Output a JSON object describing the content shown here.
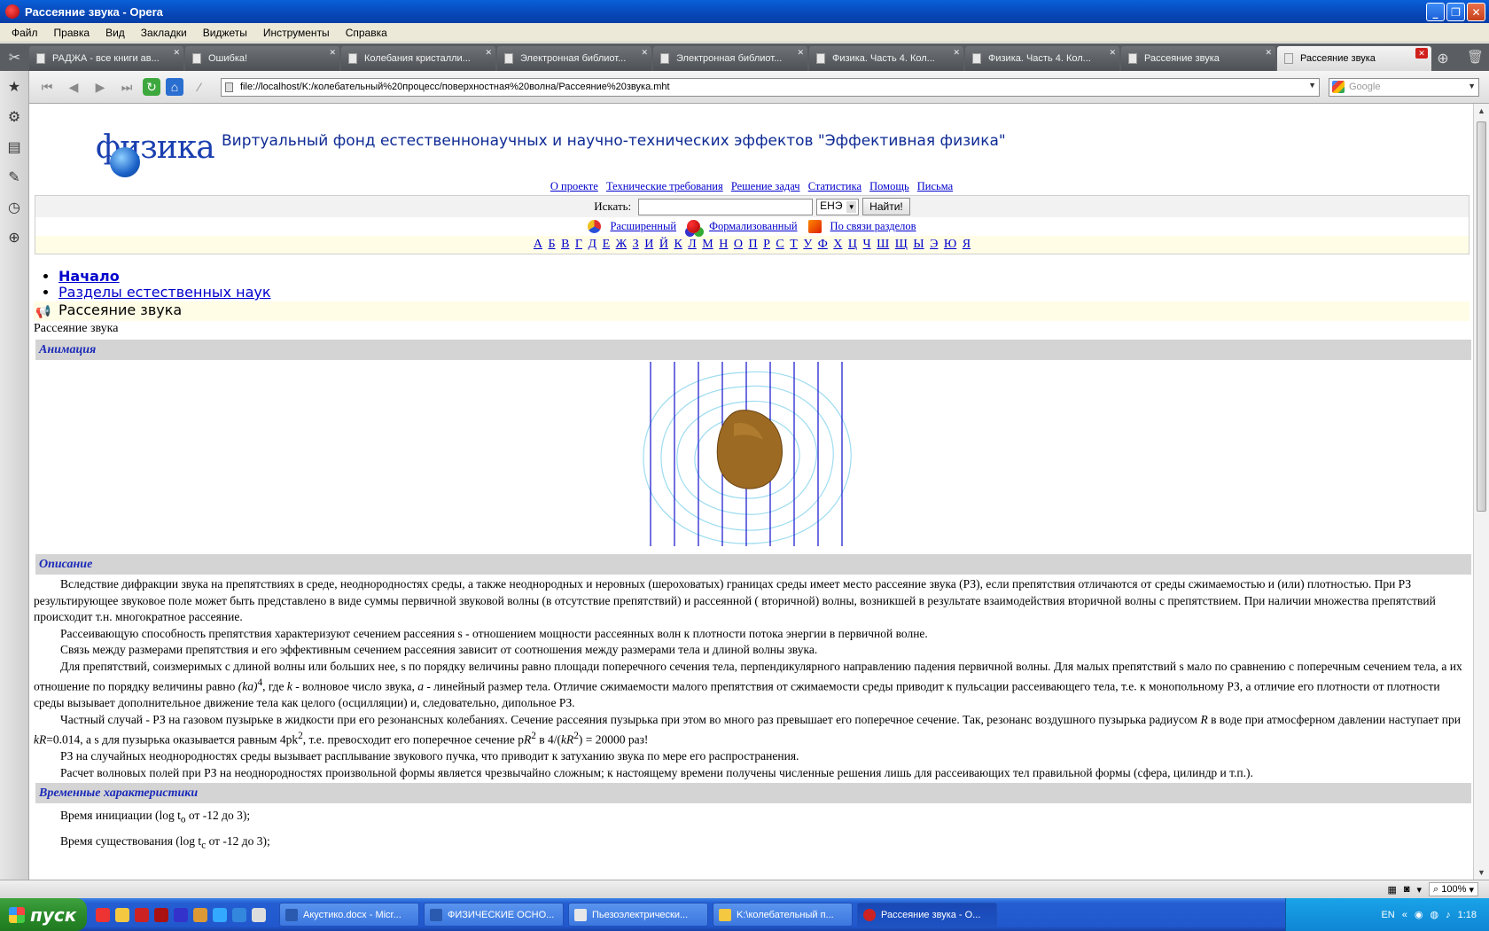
{
  "window": {
    "title": "Рассеяние звука - Opera",
    "buttons": {
      "minimize": "_",
      "maximize": "❐",
      "close": "✕"
    }
  },
  "menu": [
    "Файл",
    "Правка",
    "Вид",
    "Закладки",
    "Виджеты",
    "Инструменты",
    "Справка"
  ],
  "tabs": [
    {
      "label": "РАДЖА - все книги ав..."
    },
    {
      "label": "Ошибка!"
    },
    {
      "label": "Колебания кристалли..."
    },
    {
      "label": "Электронная библиот..."
    },
    {
      "label": "Электронная библиот..."
    },
    {
      "label": "Физика. Часть 4. Кол..."
    },
    {
      "label": "Физика. Часть 4. Кол..."
    },
    {
      "label": "Рассеяние звука"
    },
    {
      "label": "Рассеяние звука",
      "active": true
    }
  ],
  "address": {
    "url": "file://localhost/K:/колебательный%20процесс/поверхностная%20волна/Рассеяние%20звука.mht",
    "search_placeholder": "Google"
  },
  "site": {
    "logo": "физика",
    "title": "Виртуальный фонд естественнонаучных и научно-технических эффектов \"Эффективная физика\"",
    "top_links": [
      "О проекте",
      "Технические требования",
      "Решение задач",
      "Статистика",
      "Помощь",
      "Письма"
    ],
    "search": {
      "label": "Искать:",
      "select_value": "ЕНЭ",
      "button": "Найти!"
    },
    "search_types": [
      "Расширенный",
      "Формализованный",
      "По связи разделов"
    ],
    "alphabet": [
      "А",
      "Б",
      "В",
      "Г",
      "Д",
      "Е",
      "Ж",
      "З",
      "И",
      "Й",
      "К",
      "Л",
      "М",
      "Н",
      "О",
      "П",
      "Р",
      "С",
      "Т",
      "У",
      "Ф",
      "Х",
      "Ц",
      "Ч",
      "Ш",
      "Щ",
      "Ы",
      "Э",
      "Ю",
      "Я"
    ]
  },
  "breadcrumbs": [
    "Начало",
    "Разделы естественных наук"
  ],
  "current_page": "Рассеяние звука",
  "plain_title": "Рассеяние звука",
  "sections": {
    "animation": "Анимация",
    "description": "Описание",
    "time": "Временные характеристики"
  },
  "description": {
    "p1": "Вследствие дифракции звука на препятствиях в среде, неоднородностях среды, а также неоднородных и неровных (шероховатых) границах среды имеет место рассеяние звука (РЗ), если препятствия отличаются от среды сжимаемостью и (или) плотностью. При РЗ результирующее звуковое поле может быть представлено в виде суммы первичной звуковой волны (в отсутствие препятствий) и рассеянной ( вторичной) волны, возникшей в результате взаимодействия вторичной волны с препятствием. При наличии множества препятствий происходит т.н. многократное рассеяние.",
    "p2": "Рассеивающую способность препятствия характеризуют сечением рассеяния s - отношением мощности рассеянных волн к плотности потока энергии в первичной волне.",
    "p3": "Связь между размерами препятствия и его эффективным сечением рассеяния зависит от соотношения между размерами тела и длиной волны звука.",
    "p4a": "Для препятствий, соизмеримых с длиной волны или больших нее, s по порядку величины равно площади поперечного сечения тела, перпендикулярного направлению падения первичной волны. Для малых препятствий s мало по сравнению с поперечным сечением тела, а их отношение по порядку величины равно ",
    "p4_ka": "(ka)",
    "p4_exp": "4",
    "p4b": ", где ",
    "p4_k": "k",
    "p4c": " - волновое число звука, ",
    "p4_a": "a",
    "p4d": " - линейный размер тела. Отличие сжимаемости малого препятствия от сжимаемости среды приводит к пульсации рассеивающего тела, т.е. к монопольному РЗ, а отличие его плотности от плотности среды вызывает дополнительное движение тела как целого (осцилляции) и, следовательно, дипольное РЗ.",
    "p5a": "Частный случай - РЗ на газовом пузырьке в жидкости при его резонансных колебаниях. Сечение рассеяния пузырька при этом во много раз превышает его поперечное сечение. Так, резонанс воздушного пузырька радиусом ",
    "p5_R": "R",
    "p5b": " в воде при атмосферном давлении наступает при ",
    "p5_kR": "kR",
    "p5c": "=0.014, а s для пузырька оказывается равным 4pk",
    "p5_exp": "2",
    "p5d": ", т.е. превосходит его поперечное сечение p",
    "p5_R2": "R",
    "p5_exp2": "2",
    "p5e": " в 4/(",
    "p5_kR2": "kR",
    "p5_exp3": "2",
    "p5f": ") = 20000 раз!",
    "p6": "РЗ на случайных неоднородностях среды вызывает расплывание звукового пучка, что приводит к затуханию звука по мере его распространения.",
    "p7": "Расчет волновых полей при РЗ на неоднородностях произвольной формы является чрезвычайно сложным; к настоящему времени получены численные решения лишь для рассеивающих тел правильной формы (сфера, цилиндр и т.п.)."
  },
  "times": {
    "t1a": "Время инициации (log t",
    "t1_sub": "o",
    "t1b": " от -12 до 3);",
    "t2a": "Время существования (log t",
    "t2_sub": "c",
    "t2b": " от -12 до 3);"
  },
  "status": {
    "zoom": "100%"
  },
  "taskbar": {
    "start": "пуск",
    "tasks": [
      {
        "label": "Акустико.docx - Micr..."
      },
      {
        "label": "ФИЗИЧЕСКИЕ ОСНО..."
      },
      {
        "label": "Пьезоэлектрически..."
      },
      {
        "label": "K:\\колебательный п..."
      },
      {
        "label": "Рассеяние звука - O...",
        "active": true
      }
    ],
    "lang": "EN",
    "clock": "1:18"
  }
}
